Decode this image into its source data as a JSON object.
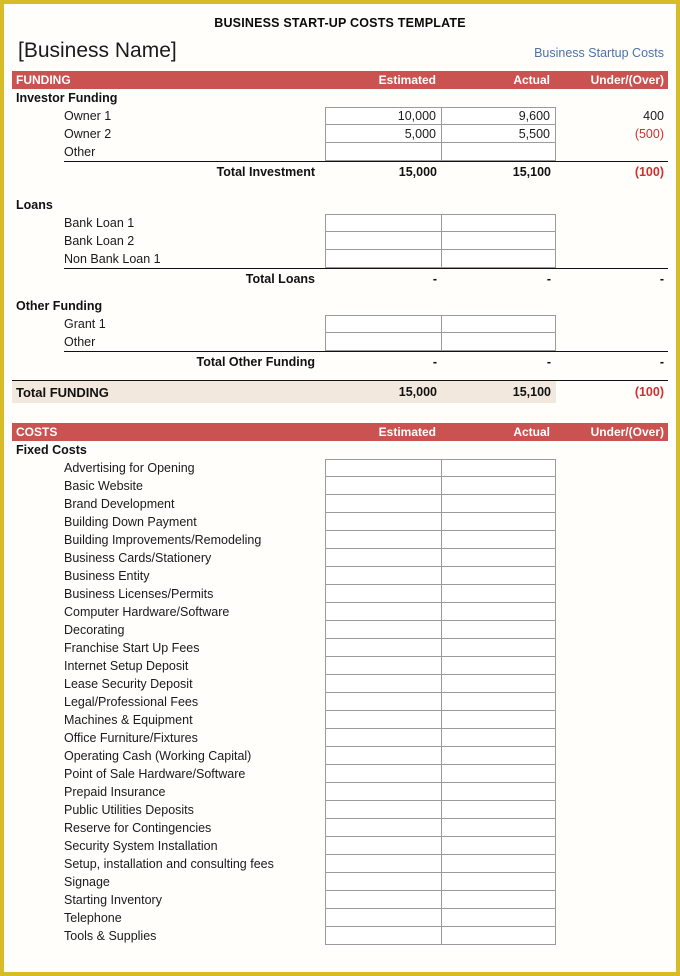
{
  "document": {
    "title": "BUSINESS START-UP COSTS TEMPLATE",
    "business_name": "[Business Name]",
    "link_label": "Business Startup Costs"
  },
  "columns": {
    "estimated": "Estimated",
    "actual": "Actual",
    "under_over": "Under/(Over)"
  },
  "funding": {
    "bar_label": "FUNDING",
    "investor": {
      "group_label": "Investor Funding",
      "rows": [
        {
          "label": "Owner 1",
          "estimated": "10,000",
          "actual": "9,600",
          "under_over": "400",
          "negative": false
        },
        {
          "label": "Owner 2",
          "estimated": "5,000",
          "actual": "5,500",
          "under_over": "(500)",
          "negative": true
        },
        {
          "label": "Other",
          "estimated": "",
          "actual": "",
          "under_over": "",
          "negative": false
        }
      ],
      "total": {
        "label": "Total Investment",
        "estimated": "15,000",
        "actual": "15,100",
        "under_over": "(100)",
        "negative": true
      }
    },
    "loans": {
      "group_label": "Loans",
      "rows": [
        {
          "label": "Bank Loan 1",
          "estimated": "",
          "actual": "",
          "under_over": "",
          "negative": false
        },
        {
          "label": "Bank Loan 2",
          "estimated": "",
          "actual": "",
          "under_over": "",
          "negative": false
        },
        {
          "label": "Non Bank Loan 1",
          "estimated": "",
          "actual": "",
          "under_over": "",
          "negative": false
        }
      ],
      "total": {
        "label": "Total Loans",
        "estimated": "-",
        "actual": "-",
        "under_over": "-",
        "negative": false
      }
    },
    "other": {
      "group_label": "Other Funding",
      "rows": [
        {
          "label": "Grant 1",
          "estimated": "",
          "actual": "",
          "under_over": "",
          "negative": false
        },
        {
          "label": "Other",
          "estimated": "",
          "actual": "",
          "under_over": "",
          "negative": false
        }
      ],
      "total": {
        "label": "Total Other Funding",
        "estimated": "-",
        "actual": "-",
        "under_over": "-",
        "negative": false
      }
    },
    "grand_total": {
      "label": "Total FUNDING",
      "estimated": "15,000",
      "actual": "15,100",
      "under_over": "(100)",
      "negative": true
    }
  },
  "costs": {
    "bar_label": "COSTS",
    "fixed": {
      "group_label": "Fixed Costs",
      "rows": [
        {
          "label": "Advertising for Opening",
          "estimated": "",
          "actual": "",
          "under_over": ""
        },
        {
          "label": "Basic Website",
          "estimated": "",
          "actual": "",
          "under_over": ""
        },
        {
          "label": "Brand Development",
          "estimated": "",
          "actual": "",
          "under_over": ""
        },
        {
          "label": "Building Down Payment",
          "estimated": "",
          "actual": "",
          "under_over": ""
        },
        {
          "label": "Building Improvements/Remodeling",
          "estimated": "",
          "actual": "",
          "under_over": ""
        },
        {
          "label": "Business Cards/Stationery",
          "estimated": "",
          "actual": "",
          "under_over": ""
        },
        {
          "label": "Business Entity",
          "estimated": "",
          "actual": "",
          "under_over": ""
        },
        {
          "label": "Business Licenses/Permits",
          "estimated": "",
          "actual": "",
          "under_over": ""
        },
        {
          "label": "Computer Hardware/Software",
          "estimated": "",
          "actual": "",
          "under_over": ""
        },
        {
          "label": "Decorating",
          "estimated": "",
          "actual": "",
          "under_over": ""
        },
        {
          "label": "Franchise Start Up Fees",
          "estimated": "",
          "actual": "",
          "under_over": ""
        },
        {
          "label": "Internet Setup Deposit",
          "estimated": "",
          "actual": "",
          "under_over": ""
        },
        {
          "label": "Lease Security Deposit",
          "estimated": "",
          "actual": "",
          "under_over": ""
        },
        {
          "label": "Legal/Professional Fees",
          "estimated": "",
          "actual": "",
          "under_over": ""
        },
        {
          "label": "Machines & Equipment",
          "estimated": "",
          "actual": "",
          "under_over": ""
        },
        {
          "label": "Office Furniture/Fixtures",
          "estimated": "",
          "actual": "",
          "under_over": ""
        },
        {
          "label": "Operating Cash (Working Capital)",
          "estimated": "",
          "actual": "",
          "under_over": ""
        },
        {
          "label": "Point of Sale Hardware/Software",
          "estimated": "",
          "actual": "",
          "under_over": ""
        },
        {
          "label": "Prepaid Insurance",
          "estimated": "",
          "actual": "",
          "under_over": ""
        },
        {
          "label": "Public Utilities Deposits",
          "estimated": "",
          "actual": "",
          "under_over": ""
        },
        {
          "label": "Reserve for Contingencies",
          "estimated": "",
          "actual": "",
          "under_over": ""
        },
        {
          "label": "Security System Installation",
          "estimated": "",
          "actual": "",
          "under_over": ""
        },
        {
          "label": "Setup, installation and consulting fees",
          "estimated": "",
          "actual": "",
          "under_over": ""
        },
        {
          "label": "Signage",
          "estimated": "",
          "actual": "",
          "under_over": ""
        },
        {
          "label": "Starting Inventory",
          "estimated": "",
          "actual": "",
          "under_over": ""
        },
        {
          "label": "Telephone",
          "estimated": "",
          "actual": "",
          "under_over": ""
        },
        {
          "label": "Tools & Supplies",
          "estimated": "",
          "actual": "",
          "under_over": ""
        }
      ]
    }
  },
  "theme": {
    "header_red": "#ca5250",
    "total_beige": "#f3e8dd",
    "link_blue": "#4a73a8",
    "frame_gold": "#d8bc27",
    "negative_red": "#d02f2f"
  }
}
